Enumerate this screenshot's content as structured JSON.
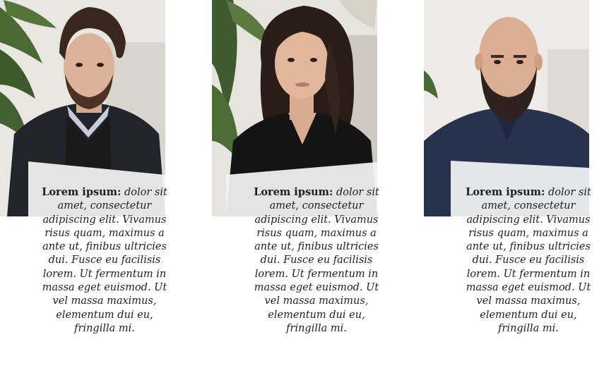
{
  "team": {
    "members": [
      {
        "portrait_icon": "portrait-man-dark-hair-icon",
        "caption_lead": "Lorem ipsum:",
        "caption_body": " dolor sit amet, consectetur adipiscing elit. Vivamus risus quam, maximus a ante ut, finibus ultricies dui. Fusce eu facilisis lorem. Ut fermentum in massa eget euismod. Ut vel massa maximus, elementum dui eu, fringilla mi."
      },
      {
        "portrait_icon": "portrait-woman-dark-hair-icon",
        "caption_lead": "Lorem ipsum:",
        "caption_body": " dolor sit amet, consectetur adipiscing elit. Vivamus risus quam, maximus a ante ut, finibus ultricies dui. Fusce eu facilisis lorem. Ut fermentum in massa eget euismod. Ut vel massa maximus, elementum dui eu, fringilla mi."
      },
      {
        "portrait_icon": "portrait-bald-bearded-man-icon",
        "caption_lead": "Lorem ipsum:",
        "caption_body": " dolor sit amet, consectetur adipiscing elit. Vivamus risus quam, maximus a ante ut, finibus ultricies dui. Fusce eu facilisis lorem. Ut fermentum in massa eget euismod. Ut vel massa maximus, elementum dui eu, fringilla mi."
      }
    ]
  },
  "colors": {
    "background": "#ffffff",
    "wall": "#ecebe7",
    "plant": "#3f5a2f",
    "text": "#1e1e1e",
    "overlay": "#f4f4f4"
  }
}
